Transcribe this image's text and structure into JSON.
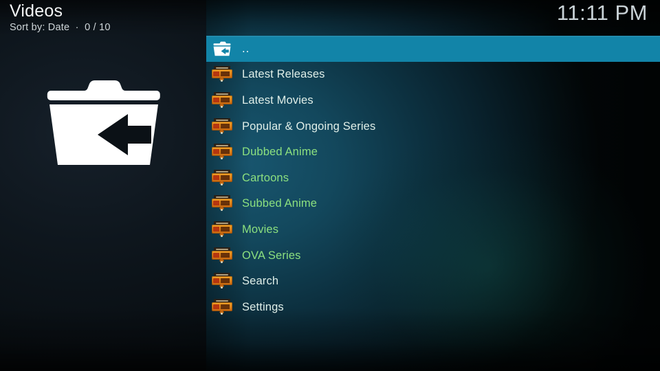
{
  "header": {
    "title": "Videos",
    "subtitle": "Sort by: Date  ·  0 / 10"
  },
  "clock": {
    "time": "11:11 PM"
  },
  "preview": {
    "icon": "parent-folder-icon"
  },
  "colors": {
    "highlight": "#1284a8",
    "label_pale": "#dfeee8",
    "label_green": "#8ce07f",
    "panel_left_bg": "#0d1419",
    "panel_right_bg": "#13485d"
  },
  "list": {
    "selected_index": 0,
    "items": [
      {
        "label": "..",
        "icon": "parent-folder-icon",
        "style": "sel",
        "selected": true
      },
      {
        "label": "Latest Releases",
        "icon": "addon-thumb-icon",
        "style": "pale",
        "selected": false
      },
      {
        "label": "Latest Movies",
        "icon": "addon-thumb-icon",
        "style": "pale",
        "selected": false
      },
      {
        "label": "Popular & Ongoing Series",
        "icon": "addon-thumb-icon",
        "style": "pale",
        "selected": false
      },
      {
        "label": "Dubbed Anime",
        "icon": "addon-thumb-icon",
        "style": "green",
        "selected": false
      },
      {
        "label": "Cartoons",
        "icon": "addon-thumb-icon",
        "style": "green",
        "selected": false
      },
      {
        "label": "Subbed Anime",
        "icon": "addon-thumb-icon",
        "style": "green",
        "selected": false
      },
      {
        "label": "Movies",
        "icon": "addon-thumb-icon",
        "style": "green",
        "selected": false
      },
      {
        "label": "OVA Series",
        "icon": "addon-thumb-icon",
        "style": "green",
        "selected": false
      },
      {
        "label": "Search",
        "icon": "addon-thumb-icon",
        "style": "pale",
        "selected": false
      },
      {
        "label": "Settings",
        "icon": "addon-thumb-icon",
        "style": "pale",
        "selected": false
      }
    ]
  }
}
